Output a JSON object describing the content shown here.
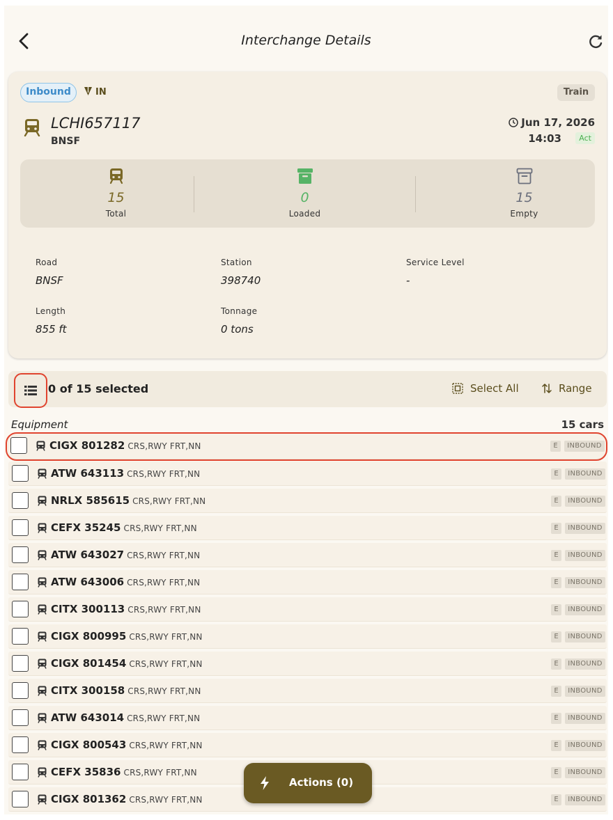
{
  "header": {
    "title": "Interchange Details",
    "back_icon": "chevron-left-icon",
    "refresh_icon": "refresh-icon"
  },
  "train": {
    "direction_pill": "Inbound",
    "direction_code": "IN",
    "type_pill": "Train",
    "id": "LCHI657117",
    "road": "BNSF",
    "date": "Jun 17, 2026",
    "time": "14:03",
    "time_badge": "Act"
  },
  "stats": [
    {
      "value": "15",
      "label": "Total",
      "icon": "train-icon",
      "color": "#7a6826"
    },
    {
      "value": "0",
      "label": "Loaded",
      "icon": "archive-filled-icon",
      "color": "#56b366"
    },
    {
      "value": "15",
      "label": "Empty",
      "icon": "archive-outline-icon",
      "color": "#6b6f7c"
    }
  ],
  "fields": {
    "road": {
      "label": "Road",
      "value": "BNSF"
    },
    "station": {
      "label": "Station",
      "value": "398740"
    },
    "service_level": {
      "label": "Service Level",
      "value": "-"
    },
    "length": {
      "label": "Length",
      "value": "855 ft"
    },
    "tonnage": {
      "label": "Tonnage",
      "value": "0 tons"
    }
  },
  "selection": {
    "count_text": "0 of 15 selected",
    "select_all": "Select All",
    "range": "Range"
  },
  "equipment": {
    "label": "Equipment",
    "count": "15 cars",
    "rows": [
      {
        "id": "CIGX 801282",
        "type": "CRS,RWY FRT,NN",
        "load": "E",
        "status": "INBOUND"
      },
      {
        "id": "ATW 643113",
        "type": "CRS,RWY FRT,NN",
        "load": "E",
        "status": "INBOUND"
      },
      {
        "id": "NRLX 585615",
        "type": "CRS,RWY FRT,NN",
        "load": "E",
        "status": "INBOUND"
      },
      {
        "id": "CEFX 35245",
        "type": "CRS,RWY FRT,NN",
        "load": "E",
        "status": "INBOUND"
      },
      {
        "id": "ATW 643027",
        "type": "CRS,RWY FRT,NN",
        "load": "E",
        "status": "INBOUND"
      },
      {
        "id": "ATW 643006",
        "type": "CRS,RWY FRT,NN",
        "load": "E",
        "status": "INBOUND"
      },
      {
        "id": "CITX 300113",
        "type": "CRS,RWY FRT,NN",
        "load": "E",
        "status": "INBOUND"
      },
      {
        "id": "CIGX 800995",
        "type": "CRS,RWY FRT,NN",
        "load": "E",
        "status": "INBOUND"
      },
      {
        "id": "CIGX 801454",
        "type": "CRS,RWY FRT,NN",
        "load": "E",
        "status": "INBOUND"
      },
      {
        "id": "CITX 300158",
        "type": "CRS,RWY FRT,NN",
        "load": "E",
        "status": "INBOUND"
      },
      {
        "id": "ATW 643014",
        "type": "CRS,RWY FRT,NN",
        "load": "E",
        "status": "INBOUND"
      },
      {
        "id": "CIGX 800543",
        "type": "CRS,RWY FRT,NN",
        "load": "E",
        "status": "INBOUND"
      },
      {
        "id": "CEFX 35836",
        "type": "CRS,RWY FRT,NN",
        "load": "E",
        "status": "INBOUND"
      },
      {
        "id": "CIGX 801362",
        "type": "CRS,RWY FRT,NN",
        "load": "E",
        "status": "INBOUND"
      }
    ]
  },
  "fab": {
    "label": "Actions (0)",
    "icon": "lightning-icon"
  }
}
